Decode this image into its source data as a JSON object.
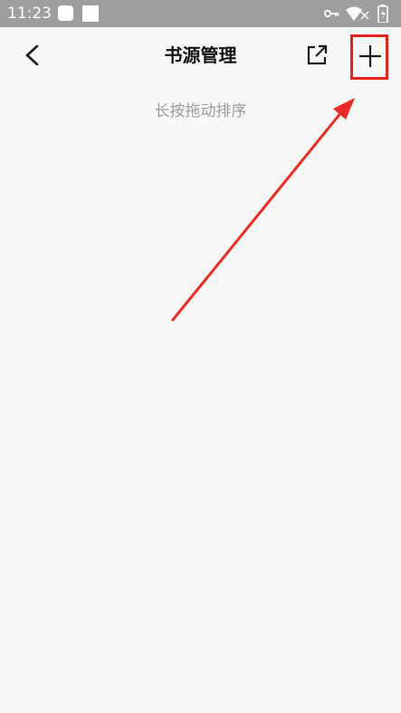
{
  "status_bar": {
    "time": "11:23",
    "icons": [
      "notification-square-icon",
      "notification-box-icon",
      "vpn-key-icon",
      "wifi-icon",
      "battery-icon"
    ]
  },
  "toolbar": {
    "title": "书源管理",
    "back_icon": "chevron-left-icon",
    "share_icon": "external-share-icon",
    "add_icon": "plus-icon"
  },
  "content": {
    "hint": "长按拖动排序"
  },
  "annotation": {
    "highlight_color": "#e8231f"
  },
  "colors": {
    "background": "#f7f7f7",
    "status_bar": "#9e9e9e",
    "hint_text": "#9a9a9a"
  }
}
